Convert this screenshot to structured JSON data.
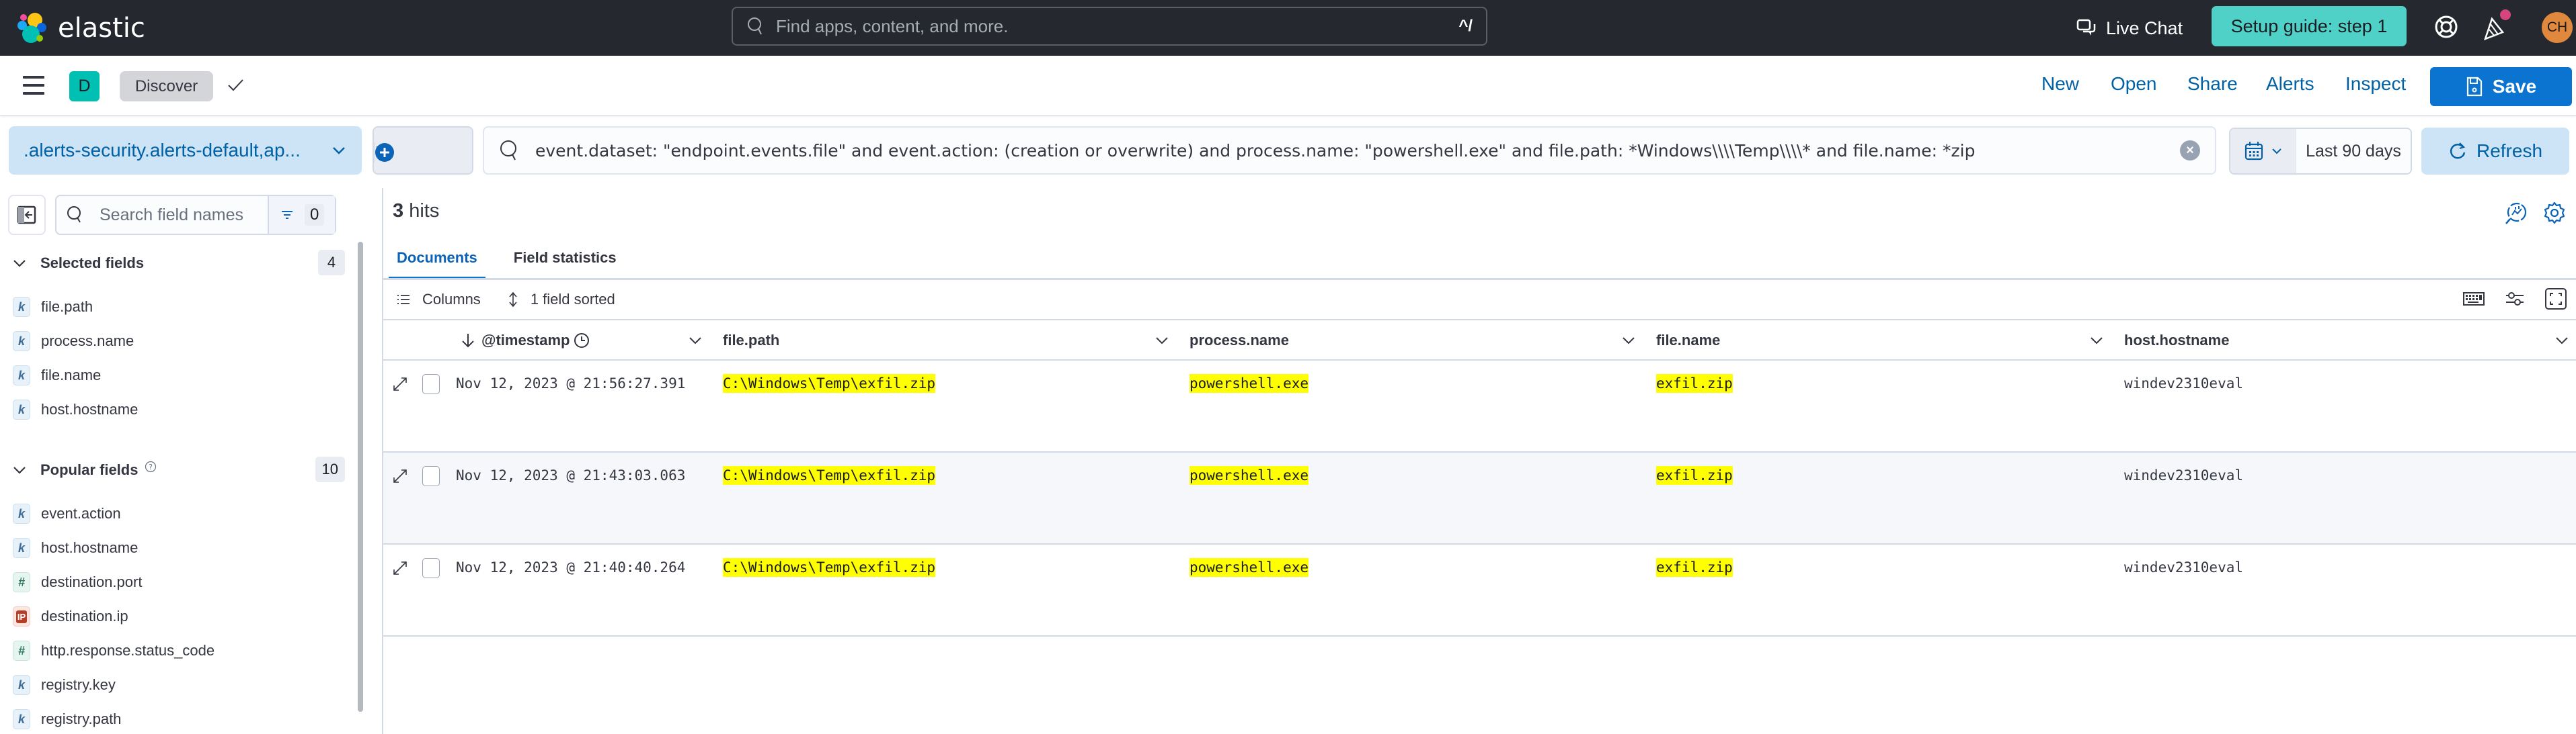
{
  "top_bar": {
    "brand": "elastic",
    "search_placeholder": "Find apps, content, and more.",
    "search_shortcut": "^/",
    "live_chat_label": "Live Chat",
    "setup_guide_label": "Setup guide: step 1",
    "avatar_initials": "CH",
    "icons": [
      "elastic-logo-icon",
      "search-icon",
      "chat-icon",
      "help-icon",
      "news-icon",
      "avatar"
    ]
  },
  "nav_bar": {
    "space_initial": "D",
    "breadcrumb": "Discover",
    "links": [
      "New",
      "Open",
      "Share",
      "Alerts",
      "Inspect"
    ],
    "save_label": "Save"
  },
  "query_bar": {
    "data_view": ".alerts-security.alerts-default,ap...",
    "query": "event.dataset: \"endpoint.events.file\" and event.action: (creation or overwrite) and process.name: \"powershell.exe\" and file.path: *Windows\\\\\\\\Temp\\\\\\\\* and file.name: *zip",
    "time_range": "Last 90 days",
    "refresh_label": "Refresh"
  },
  "sidebar": {
    "search_placeholder": "Search field names",
    "filter_count": "0",
    "selected_fields": {
      "title": "Selected fields",
      "count": "4",
      "items": [
        {
          "type": "k",
          "name": "file.path"
        },
        {
          "type": "k",
          "name": "process.name"
        },
        {
          "type": "k",
          "name": "file.name"
        },
        {
          "type": "k",
          "name": "host.hostname"
        }
      ]
    },
    "popular_fields": {
      "title": "Popular fields",
      "count": "10",
      "items": [
        {
          "type": "k",
          "name": "event.action"
        },
        {
          "type": "k",
          "name": "host.hostname"
        },
        {
          "type": "#",
          "name": "destination.port"
        },
        {
          "type": "IP",
          "name": "destination.ip"
        },
        {
          "type": "#",
          "name": "http.response.status_code"
        },
        {
          "type": "k",
          "name": "registry.key"
        },
        {
          "type": "k",
          "name": "registry.path"
        }
      ]
    }
  },
  "main": {
    "hits_count": "3",
    "hits_label": "hits",
    "tabs": [
      "Documents",
      "Field statistics"
    ],
    "active_tab": "Documents",
    "toolbar": {
      "columns_label": "Columns",
      "sort_label": "1 field sorted"
    },
    "columns": [
      "@timestamp",
      "file.path",
      "process.name",
      "file.name",
      "host.hostname"
    ],
    "rows": [
      {
        "timestamp": "Nov 12, 2023 @ 21:56:27.391",
        "file_path": "C:\\Windows\\Temp\\exfil.zip",
        "process_name": "powershell.exe",
        "file_name": "exfil.zip",
        "host_hostname": "windev2310eval"
      },
      {
        "timestamp": "Nov 12, 2023 @ 21:43:03.063",
        "file_path": "C:\\Windows\\Temp\\exfil.zip",
        "process_name": "powershell.exe",
        "file_name": "exfil.zip",
        "host_hostname": "windev2310eval"
      },
      {
        "timestamp": "Nov 12, 2023 @ 21:40:40.264",
        "file_path": "C:\\Windows\\Temp\\exfil.zip",
        "process_name": "powershell.exe",
        "file_name": "exfil.zip",
        "host_hostname": "windev2310eval"
      }
    ]
  },
  "colors": {
    "header_bg": "#25282f",
    "accent": "#0b74d1",
    "setup_guide": "#4fd1c8",
    "highlight": "#ffff00",
    "avatar": "#e0883d",
    "space_badge": "#00bfb3"
  }
}
